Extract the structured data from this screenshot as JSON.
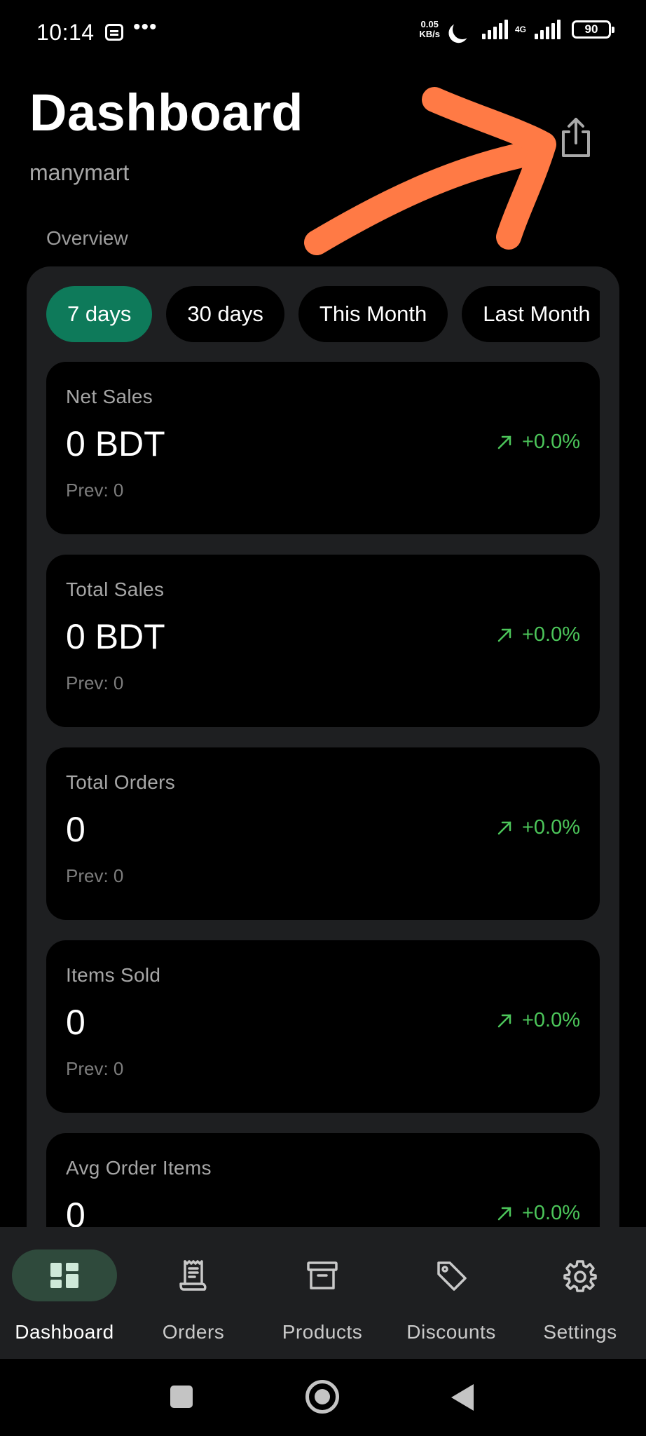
{
  "status_bar": {
    "time": "10:14",
    "dots": "•••",
    "net_speed_value": "0.05",
    "net_speed_unit": "KB/s",
    "network_type": "4G",
    "battery": "90"
  },
  "header": {
    "title": "Dashboard",
    "store_name": "manymart",
    "share_icon": "share-icon"
  },
  "overview": {
    "section_label": "Overview",
    "ranges": [
      {
        "label": "7 days",
        "active": true
      },
      {
        "label": "30 days",
        "active": false
      },
      {
        "label": "This Month",
        "active": false
      },
      {
        "label": "Last Month",
        "active": false
      }
    ]
  },
  "metrics": [
    {
      "label": "Net Sales",
      "value": "0 BDT",
      "prev": "Prev: 0",
      "change": "+0.0%"
    },
    {
      "label": "Total Sales",
      "value": "0 BDT",
      "prev": "Prev: 0",
      "change": "+0.0%"
    },
    {
      "label": "Total Orders",
      "value": "0",
      "prev": "Prev: 0",
      "change": "+0.0%"
    },
    {
      "label": "Items Sold",
      "value": "0",
      "prev": "Prev: 0",
      "change": "+0.0%"
    },
    {
      "label": "Avg Order Items",
      "value": "0",
      "prev": "",
      "change": "+0.0%"
    }
  ],
  "bottom_nav": [
    {
      "label": "Dashboard",
      "icon": "dashboard-icon",
      "active": true
    },
    {
      "label": "Orders",
      "icon": "receipt-icon",
      "active": false
    },
    {
      "label": "Products",
      "icon": "archive-box-icon",
      "active": false
    },
    {
      "label": "Discounts",
      "icon": "tag-icon",
      "active": false
    },
    {
      "label": "Settings",
      "icon": "gear-icon",
      "active": false
    }
  ],
  "colors": {
    "accent": "#0e7a5a",
    "positive": "#4cc65a",
    "annotation": "#ff7a45",
    "panel": "#1e1f21",
    "nav_active_pill": "#2f4a3c"
  }
}
